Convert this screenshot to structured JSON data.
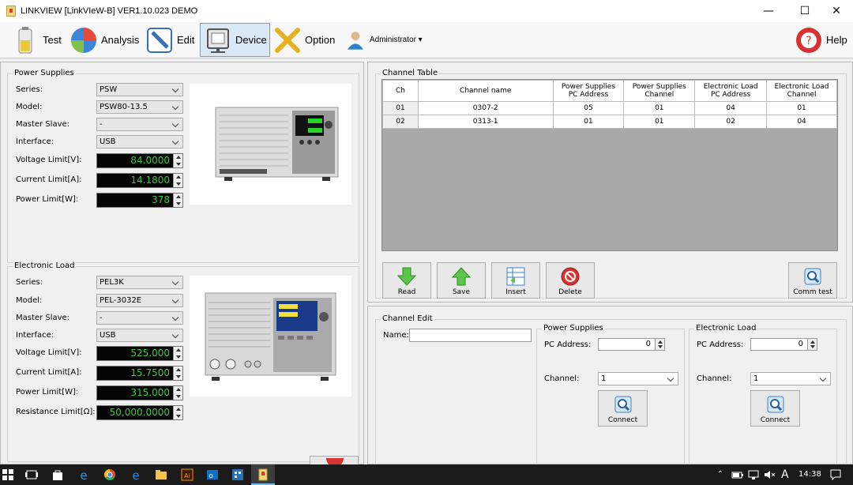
{
  "window": {
    "title": "LINKVIEW [LinkVIeW-B] VER1.10.023 DEMO",
    "minimize": "—",
    "maximize": "☐",
    "close": "✕"
  },
  "toolbar": {
    "test": "Test",
    "analysis": "Analysis",
    "edit": "Edit",
    "device": "Device",
    "option": "Option",
    "admin": "Administrator ▾",
    "help": "Help"
  },
  "ps": {
    "title": "Power Supplies",
    "series_label": "Series:",
    "series": "PSW",
    "model_label": "Model:",
    "model": "PSW80-13.5",
    "ms_label": "Master Slave:",
    "ms": "-",
    "iface_label": "Interface:",
    "iface": "USB",
    "vlim_label": "Voltage Limit[V]:",
    "vlim": "84.0000",
    "clim_label": "Current Limit[A]:",
    "clim": "14.1800",
    "plim_label": "Power Limit[W]:",
    "plim": "378"
  },
  "el": {
    "title": "Electronic Load",
    "series_label": "Series:",
    "series": "PEL3K",
    "model_label": "Model:",
    "model": "PEL-3032E",
    "ms_label": "Master Slave:",
    "ms": "-",
    "iface_label": "Interface:",
    "iface": "USB",
    "vlim_label": "Voltage Limit[V]:",
    "vlim": "525.000",
    "clim_label": "Current Limit[A]:",
    "clim": "15.7500",
    "plim_label": "Power Limit[W]:",
    "plim": "315.000",
    "rlim_label": "Resistance Limit[Ω]:",
    "rlim": "50,000.0000"
  },
  "channel_table": {
    "title": "Channel Table",
    "headers": {
      "ch": "Ch",
      "name": "Channel name",
      "ps_pc1": "Power Supplies",
      "ps_pc2": "PC Address",
      "ps_ch1": "Power Supplies",
      "ps_ch2": "Channel",
      "el_pc1": "Electronic Load",
      "el_pc2": "PC Address",
      "el_ch1": "Electronic Load",
      "el_ch2": "Channel"
    },
    "rows": [
      {
        "ch": "01",
        "name": "0307-2",
        "ps_pc": "05",
        "ps_ch": "01",
        "el_pc": "04",
        "el_ch": "01"
      },
      {
        "ch": "02",
        "name": "0313-1",
        "ps_pc": "01",
        "ps_ch": "01",
        "el_pc": "02",
        "el_ch": "04"
      }
    ]
  },
  "buttons": {
    "read": "Read",
    "save": "Save",
    "insert": "Insert",
    "delete": "Delete",
    "comm": "Comm test"
  },
  "edit": {
    "title": "Channel Edit",
    "name_label": "Name:",
    "ps_title": "Power Supplies",
    "ps_pc_label": "PC Address:",
    "ps_pc": "0",
    "ps_ch_label": "Channel:",
    "ps_ch": "1",
    "el_title": "Electronic Load",
    "el_pc_label": "PC Address:",
    "el_pc": "0",
    "el_ch_label": "Channel:",
    "el_ch": "1",
    "connect": "Connect"
  },
  "taskbar": {
    "time": "14:38",
    "ime": "A"
  }
}
